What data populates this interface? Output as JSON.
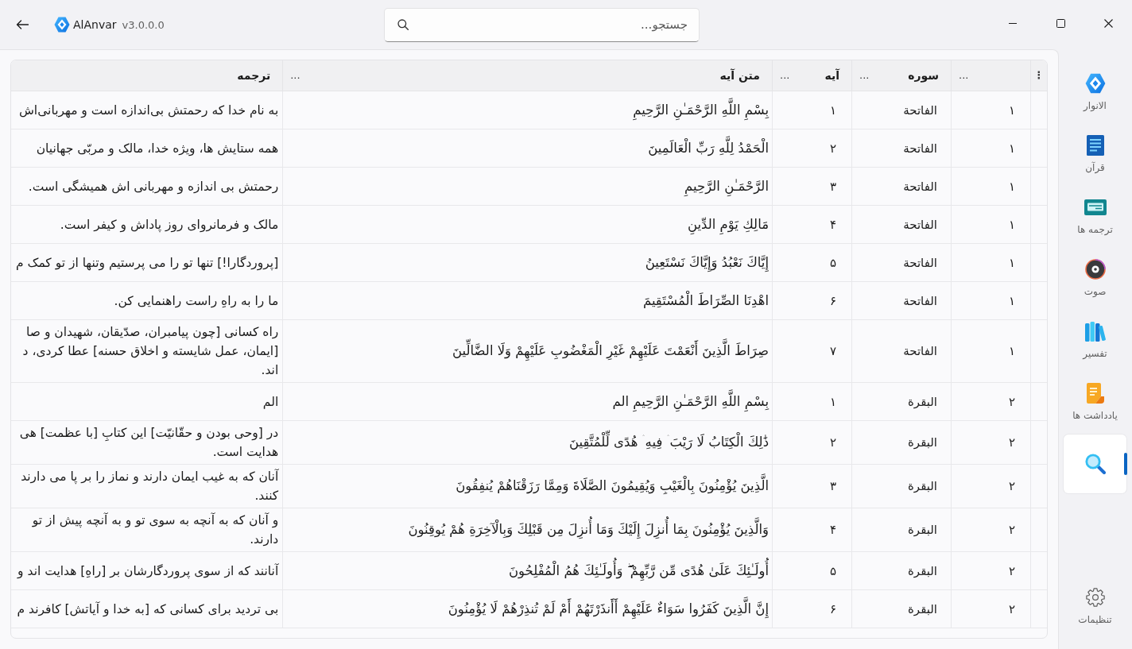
{
  "window": {
    "app_name": "AlAnvar",
    "version": "v3.0.0.0"
  },
  "search": {
    "placeholder": "جستجو..."
  },
  "table": {
    "corner_menu": "⋮",
    "columns": [
      {
        "menu": "..."
      },
      {
        "heading": "سوره",
        "menu": "..."
      },
      {
        "heading": "آیه",
        "menu": "..."
      },
      {
        "heading": "متن آیه",
        "menu": "..."
      },
      {
        "heading": "ترجمه"
      }
    ],
    "rows": [
      {
        "cells": [
          "۱",
          "الفاتحة",
          "۱",
          "بِسْمِ اللَّهِ الرَّحْمَـٰنِ الرَّحِيمِ",
          "به نام خدا که رحمتش بی‌اندازه است و مهربانی‌اش"
        ]
      },
      {
        "cells": [
          "۱",
          "الفاتحة",
          "۲",
          "الْحَمْدُ لِلَّهِ رَبِّ الْعَالَمِينَ",
          "همه ستایش ها، ویژه خدا، مالک و مربّی جهانیان"
        ]
      },
      {
        "cells": [
          "۱",
          "الفاتحة",
          "۳",
          "الرَّحْمَـٰنِ الرَّحِيمِ",
          "رحمتش بی اندازه و مهربانی اش همیشگی است."
        ]
      },
      {
        "cells": [
          "۱",
          "الفاتحة",
          "۴",
          "مَالِكِ يَوْمِ الدِّينِ",
          "مالک و فرمانروای روز پاداش و کیفر است."
        ]
      },
      {
        "cells": [
          "۱",
          "الفاتحة",
          "۵",
          "إِيَّاكَ نَعْبُدُ وَإِيَّاكَ نَسْتَعِينُ",
          "[پروردگارا!] تنها تو را می پرستیم وتنها از تو کمک م"
        ]
      },
      {
        "cells": [
          "۱",
          "الفاتحة",
          "۶",
          "اهْدِنَا الصِّرَاطَ الْمُسْتَقِيمَ",
          "ما را به راهِ راست راهنمایی کن."
        ]
      },
      {
        "cells": [
          "۱",
          "الفاتحة",
          "۷",
          "صِرَاطَ الَّذِينَ أَنْعَمْتَ عَلَيْهِمْ غَيْرِ الْمَغْضُوبِ عَلَيْهِمْ وَلَا الضَّالِّينَ",
          "راه کسانی [چون پیامبران، صدّیقان، شهیدان و صا\n[ایمان، عمل شایسته و اخلاق حسنه] عطا کردی، د\nاند."
        ]
      },
      {
        "cells": [
          "۲",
          "البقرة",
          "۱",
          "بِسْمِ اللَّهِ الرَّحْمَـٰنِ الرَّحِيمِ الم",
          "الم"
        ]
      },
      {
        "cells": [
          "۲",
          "البقرة",
          "۲",
          "ذَٰلِكَ الْكِتَابُ لَا رَيْبَ ۛ فِيهِ ۛ هُدًى لِّلْمُتَّقِينَ",
          "در [وحی بودن و حقّانیّت] این کتابِ [با عظمت] هی\nهدایت است."
        ]
      },
      {
        "cells": [
          "۲",
          "البقرة",
          "۳",
          "الَّذِينَ يُؤْمِنُونَ بِالْغَيْبِ وَيُقِيمُونَ الصَّلَاةَ وَمِمَّا رَزَقْنَاهُمْ يُنفِقُونَ",
          "آنان که به غیب ایمان دارند و نماز را بر پا می دارند\nکنند."
        ]
      },
      {
        "cells": [
          "۲",
          "البقرة",
          "۴",
          "وَالَّذِينَ يُؤْمِنُونَ بِمَا أُنزِلَ إِلَيْكَ وَمَا أُنزِلَ مِن قَبْلِكَ وَبِالْآخِرَةِ هُمْ يُوقِنُونَ",
          "و آنان که به آنچه به سوی تو و به آنچه پیش از تو\nدارند."
        ]
      },
      {
        "cells": [
          "۲",
          "البقرة",
          "۵",
          "أُولَـٰئِكَ عَلَىٰ هُدًى مِّن رَّبِّهِمْ ۖ وَأُولَـٰئِكَ هُمُ الْمُفْلِحُونَ",
          "آنانند که از سوی پروردگارشان بر [راهِ] هدایت اند و"
        ]
      },
      {
        "cells": [
          "۲",
          "البقرة",
          "۶",
          "إِنَّ الَّذِينَ كَفَرُوا سَوَاءٌ عَلَيْهِمْ أَأَنذَرْتَهُمْ أَمْ لَمْ تُنذِرْهُمْ لَا يُؤْمِنُونَ",
          "بی تردید برای کسانی که [به خدا و آیاتش] کافرند م"
        ]
      }
    ]
  },
  "sidebar": {
    "items": [
      {
        "label": "الانوار",
        "selected": false
      },
      {
        "label": "قرآن",
        "selected": false
      },
      {
        "label": "ترجمه ها",
        "selected": false
      },
      {
        "label": "صوت",
        "selected": false
      },
      {
        "label": "تفسیر",
        "selected": false
      },
      {
        "label": "یادداشت ها",
        "selected": false
      },
      {
        "selected": true
      }
    ],
    "footer_items": [
      {
        "label": "تنظیمات",
        "selected": false
      }
    ]
  }
}
